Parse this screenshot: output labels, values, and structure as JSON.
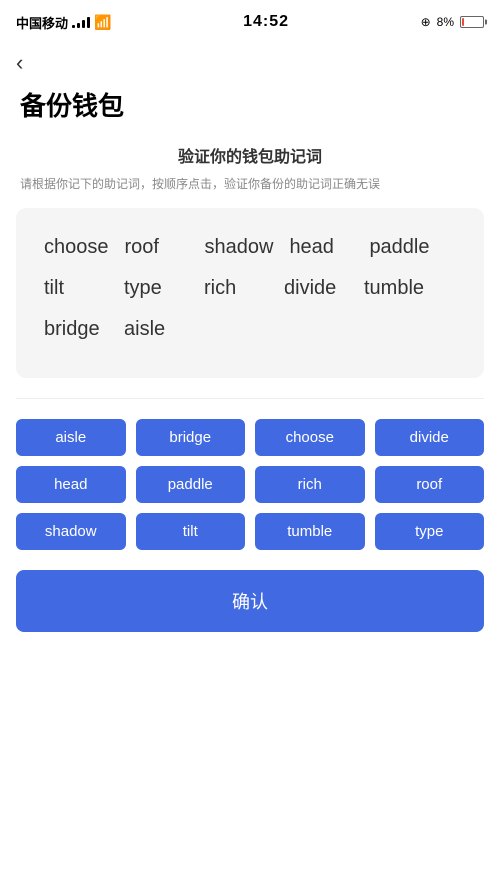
{
  "statusBar": {
    "carrier": "中国移动",
    "time": "14:52",
    "batteryPercent": "8%",
    "batteryLow": true
  },
  "nav": {
    "backLabel": "‹"
  },
  "page": {
    "title": "备份钱包",
    "sectionTitle": "验证你的钱包助记词",
    "sectionDesc": "请根据你记下的助记词，按顺序点击，验证你备份的助记词正确无误"
  },
  "displayWords": [
    "choose",
    "roof",
    "shadow",
    "head",
    "paddle",
    "tilt",
    "type",
    "rich",
    "divide",
    "tumble",
    "bridge",
    "aisle"
  ],
  "buttonWords": [
    "aisle",
    "bridge",
    "choose",
    "divide",
    "head",
    "paddle",
    "rich",
    "roof",
    "shadow",
    "tilt",
    "tumble",
    "type"
  ],
  "confirmButton": {
    "label": "确认"
  }
}
